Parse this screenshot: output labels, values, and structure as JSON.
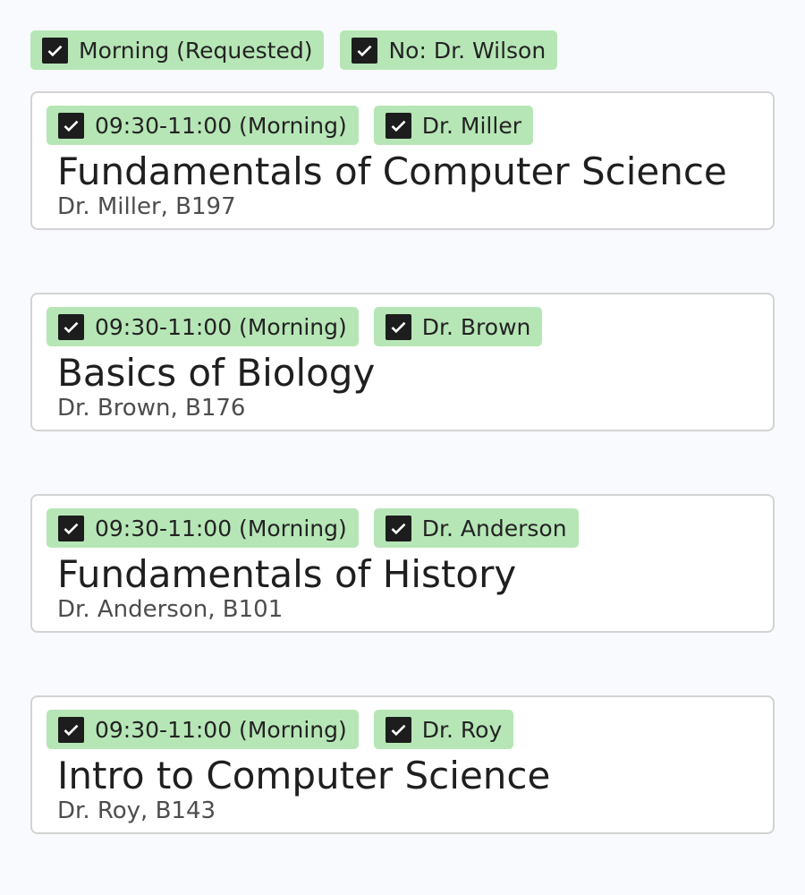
{
  "filters": [
    {
      "label": "Morning (Requested)",
      "checked": true
    },
    {
      "label": "No: Dr. Wilson",
      "checked": true
    }
  ],
  "tag_color": "#b6e6b6",
  "courses": [
    {
      "time_tag": "09:30-11:00 (Morning)",
      "instructor_tag": "Dr. Miller",
      "title": "Fundamentals of Computer Science",
      "subtitle": "Dr. Miller, B197"
    },
    {
      "time_tag": "09:30-11:00 (Morning)",
      "instructor_tag": "Dr. Brown",
      "title": "Basics of Biology",
      "subtitle": "Dr. Brown, B176"
    },
    {
      "time_tag": "09:30-11:00 (Morning)",
      "instructor_tag": "Dr. Anderson",
      "title": "Fundamentals of History",
      "subtitle": "Dr. Anderson, B101"
    },
    {
      "time_tag": "09:30-11:00 (Morning)",
      "instructor_tag": "Dr. Roy",
      "title": "Intro to Computer Science",
      "subtitle": "Dr. Roy, B143"
    }
  ]
}
